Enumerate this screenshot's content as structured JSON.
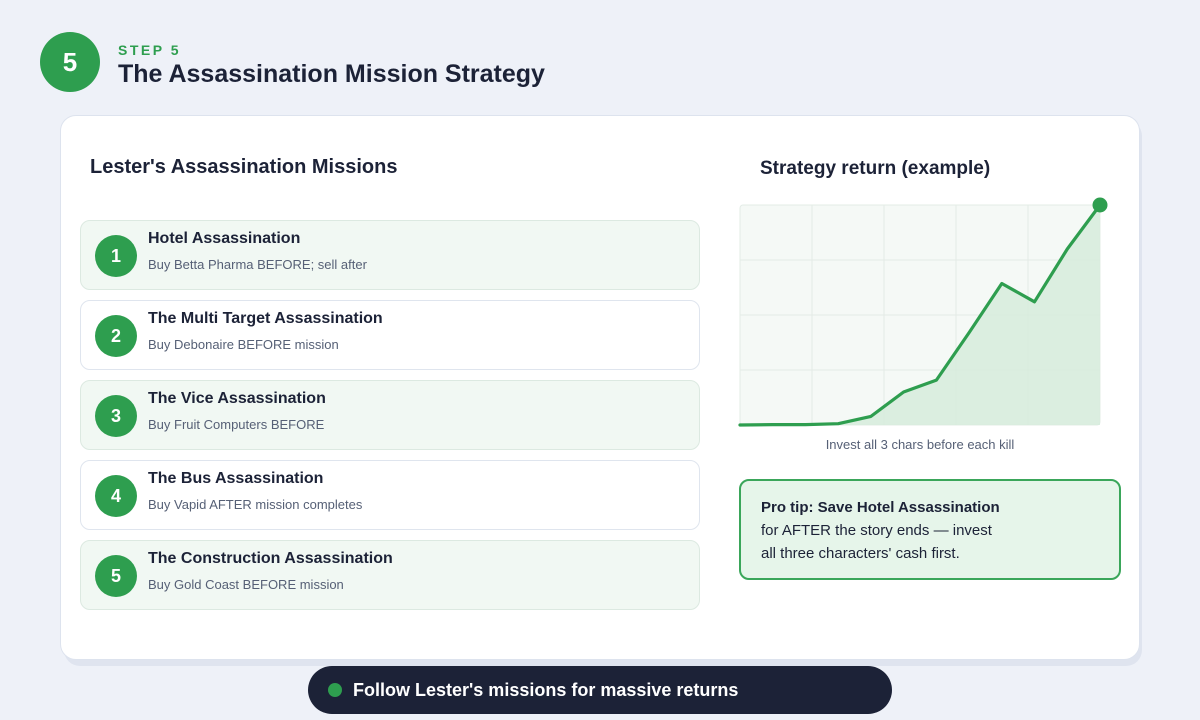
{
  "header": {
    "step_number": "5",
    "step_label": "STEP 5",
    "title": "The Assassination Mission Strategy"
  },
  "missions_section": {
    "title": "Lester's Assassination Missions",
    "items": [
      {
        "number": "1",
        "title": "Hotel Assassination",
        "description": "Buy Betta Pharma BEFORE; sell after"
      },
      {
        "number": "2",
        "title": "The Multi Target Assassination",
        "description": "Buy Debonaire BEFORE mission"
      },
      {
        "number": "3",
        "title": "The Vice Assassination",
        "description": "Buy Fruit Computers BEFORE"
      },
      {
        "number": "4",
        "title": "The Bus Assassination",
        "description": "Buy Vapid AFTER mission completes"
      },
      {
        "number": "5",
        "title": "The Construction Assassination",
        "description": "Buy Gold Coast BEFORE mission"
      }
    ]
  },
  "chart_panel": {
    "title": "Strategy return (example)",
    "caption": "Invest all 3 chars before each kill"
  },
  "chart_data": {
    "type": "area",
    "x": [
      0,
      1,
      2,
      3,
      4,
      5,
      6,
      7,
      8,
      9,
      10,
      11
    ],
    "values": [
      0,
      0.2,
      0.2,
      0.6,
      3.9,
      15,
      20.4,
      42,
      64.3,
      56,
      80,
      100
    ],
    "ylim": [
      0,
      100
    ],
    "grid": true,
    "line_color": "#2e9e4f",
    "fill_color": "#d6ecdc"
  },
  "tip": {
    "strong": "Pro tip: Save Hotel Assassination",
    "line2": "for AFTER the story ends — invest",
    "line3": "all three characters' cash first."
  },
  "footer": {
    "text": "Follow Lester's missions for massive returns"
  },
  "colors": {
    "accent": "#2e9e4f",
    "navy": "#1c2237",
    "background": "#eef1f8"
  }
}
